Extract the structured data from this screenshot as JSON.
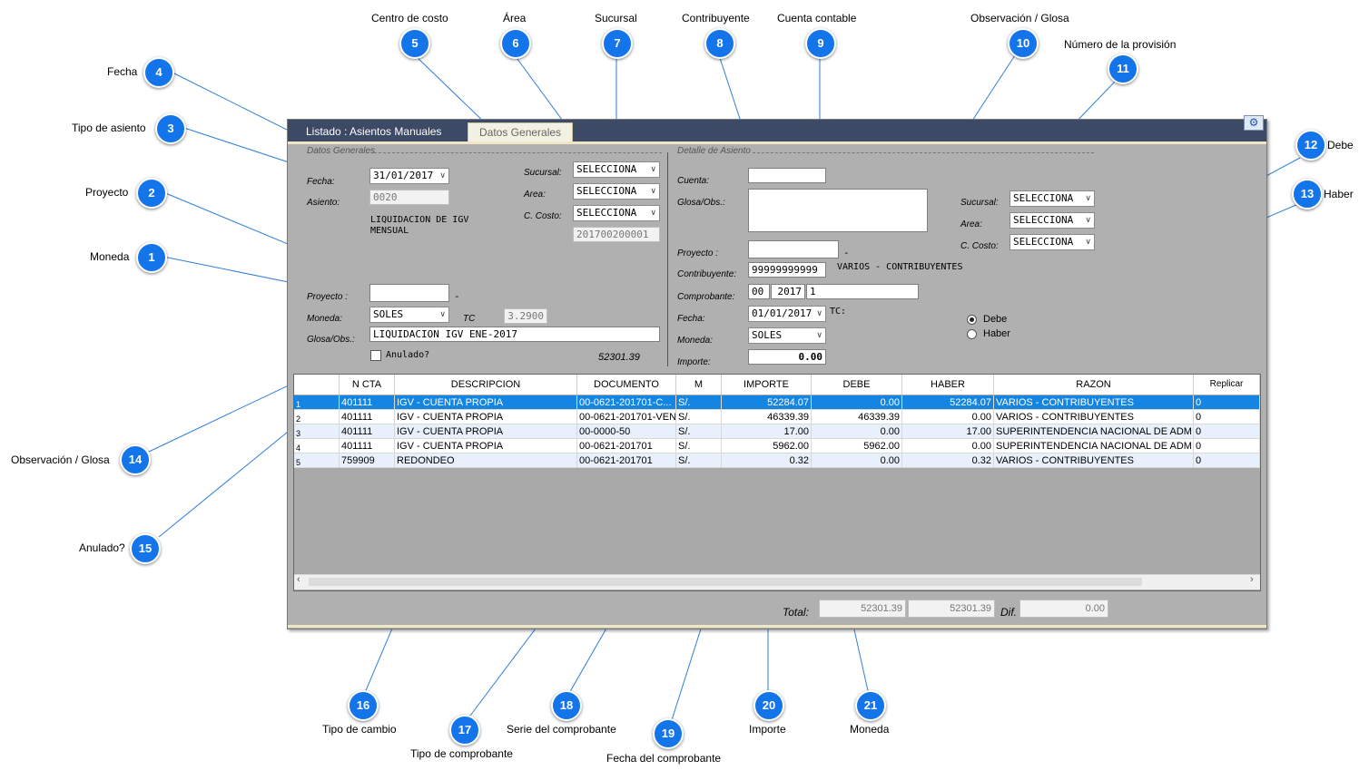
{
  "tabs": [
    {
      "label": "Listado : Asientos Manuales"
    },
    {
      "label": "Datos Generales"
    }
  ],
  "datos_generales": {
    "section_title": "Datos Generales",
    "fecha_label": "Fecha:",
    "fecha_value": "31/01/2017",
    "asiento_label": "Asiento:",
    "asiento_value": "0020",
    "tipo_asiento_line1": "LIQUIDACION DE IGV",
    "tipo_asiento_line2": "MENSUAL",
    "sucursal_label": "Sucursal:",
    "sucursal_value": "SELECCIONA",
    "area_label": "Area:",
    "area_value": "SELECCIONA",
    "ccosto_label": "C. Costo:",
    "ccosto_value": "SELECCIONA",
    "ccosto_code": "201700200001",
    "proyecto_label": "Proyecto :",
    "proyecto_value": "",
    "proyecto_dash": "-",
    "moneda_label": "Moneda:",
    "moneda_value": "SOLES",
    "tc_label": "TC",
    "tc_value": "3.2900",
    "glosa_label": "Glosa/Obs.:",
    "glosa_value": "LIQUIDACION IGV ENE-2017",
    "anulado_label": "Anulado?",
    "total_value": "52301.39"
  },
  "detalle": {
    "section_title": "Detalle de Asiento",
    "cuenta_label": "Cuenta:",
    "cuenta_value": "",
    "glosa_label": "Glosa/Obs.:",
    "glosa_value": "",
    "sucursal_label": "Sucursal:",
    "sucursal_value": "SELECCIONA",
    "area_label": "Area:",
    "area_value": "SELECCIONA",
    "ccosto_label": "C. Costo:",
    "ccosto_value": "SELECCIONA",
    "proyecto_label": "Proyecto :",
    "proyecto_value": "",
    "proyecto_dash": "-",
    "contribuyente_label": "Contribuyente:",
    "contribuyente_value": "99999999999",
    "contribuyente_name": "VARIOS - CONTRIBUYENTES",
    "comprobante_label": "Comprobante:",
    "comprobante_tipo": "00",
    "comprobante_serie": "2017",
    "comprobante_numero": "1",
    "fecha_label": "Fecha:",
    "fecha_value": "01/01/2017",
    "tc_label": "TC:",
    "moneda_label": "Moneda:",
    "moneda_value": "SOLES",
    "importe_label": "Importe:",
    "importe_value": "0.00",
    "debe_label": "Debe",
    "haber_label": "Haber",
    "debe_selected": true
  },
  "grid": {
    "columns": [
      "",
      "N CTA",
      "DESCRIPCION",
      "DOCUMENTO",
      "M",
      "IMPORTE",
      "DEBE",
      "HABER",
      "RAZON",
      "Replicar"
    ],
    "rows": [
      [
        "1",
        "401111",
        "IGV - CUENTA PROPIA",
        "00-0621-201701-C...",
        "S/.",
        "52284.07",
        "0.00",
        "52284.07",
        "VARIOS - CONTRIBUYENTES",
        "0"
      ],
      [
        "2",
        "401111",
        "IGV - CUENTA PROPIA",
        "00-0621-201701-VEN",
        "S/.",
        "46339.39",
        "46339.39",
        "0.00",
        "VARIOS - CONTRIBUYENTES",
        "0"
      ],
      [
        "3",
        "401111",
        "IGV - CUENTA PROPIA",
        "00-0000-50",
        "S/.",
        "17.00",
        "0.00",
        "17.00",
        "SUPERINTENDENCIA NACIONAL DE ADM...",
        "0"
      ],
      [
        "4",
        "401111",
        "IGV - CUENTA PROPIA",
        "00-0621-201701",
        "S/.",
        "5962.00",
        "5962.00",
        "0.00",
        "SUPERINTENDENCIA NACIONAL DE ADM...",
        "0"
      ],
      [
        "5",
        "759909",
        "REDONDEO",
        "00-0621-201701",
        "S/.",
        "0.32",
        "0.00",
        "0.32",
        "VARIOS - CONTRIBUYENTES",
        "0"
      ]
    ]
  },
  "totals": {
    "total_label": "Total:",
    "debe_total": "52301.39",
    "haber_total": "52301.39",
    "dif_label": "Dif.",
    "dif_value": "0.00"
  },
  "callouts": [
    {
      "num": "1",
      "label": "Moneda"
    },
    {
      "num": "2",
      "label": "Proyecto"
    },
    {
      "num": "3",
      "label": "Tipo de asiento"
    },
    {
      "num": "4",
      "label": "Fecha"
    },
    {
      "num": "5",
      "label": "Centro de costo"
    },
    {
      "num": "6",
      "label": "Área"
    },
    {
      "num": "7",
      "label": "Sucursal"
    },
    {
      "num": "8",
      "label": "Contribuyente"
    },
    {
      "num": "9",
      "label": "Cuenta contable"
    },
    {
      "num": "10",
      "label": "Observación / Glosa"
    },
    {
      "num": "11",
      "label": "Número de la provisión"
    },
    {
      "num": "12",
      "label": "Debe"
    },
    {
      "num": "13",
      "label": "Haber"
    },
    {
      "num": "14",
      "label": "Observación / Glosa"
    },
    {
      "num": "15",
      "label": "Anulado?"
    },
    {
      "num": "16",
      "label": "Tipo de cambio"
    },
    {
      "num": "17",
      "label": "Tipo de comprobante"
    },
    {
      "num": "18",
      "label": "Serie del comprobante"
    },
    {
      "num": "19",
      "label": "Fecha del comprobante"
    },
    {
      "num": "20",
      "label": "Importe"
    },
    {
      "num": "21",
      "label": "Moneda"
    }
  ],
  "colors": {
    "callout": "#1475ea",
    "tabbar": "#3d4a66",
    "selected_row": "#1585e3"
  }
}
